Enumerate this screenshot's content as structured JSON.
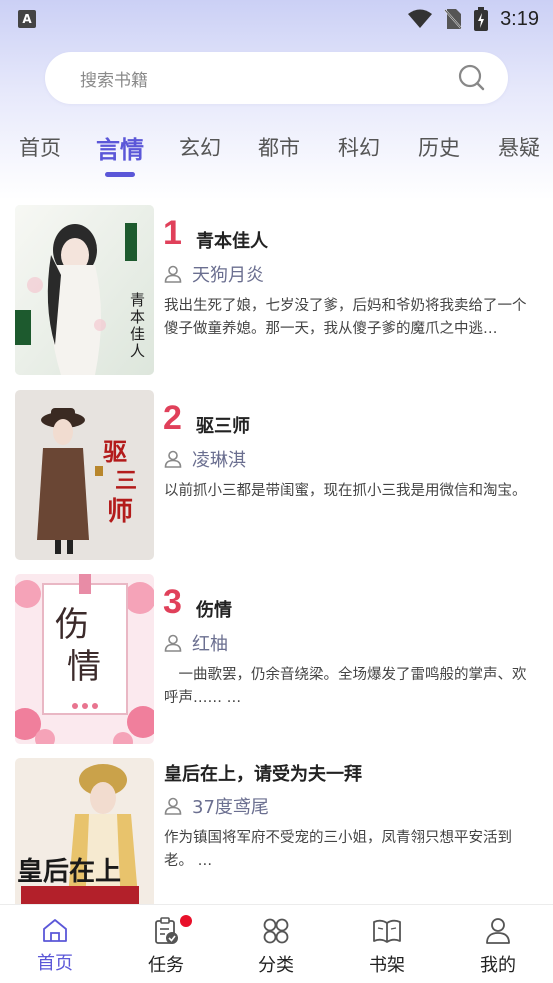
{
  "status_bar": {
    "app_badge": "A",
    "time": "3:19",
    "icons": [
      "wifi-icon",
      "no-sim-icon",
      "battery-charging-icon"
    ]
  },
  "search": {
    "placeholder": "搜索书籍",
    "icon": "search-icon"
  },
  "tabs": [
    {
      "label": "首页",
      "active": false
    },
    {
      "label": "言情",
      "active": true
    },
    {
      "label": "玄幻",
      "active": false
    },
    {
      "label": "都市",
      "active": false
    },
    {
      "label": "科幻",
      "active": false
    },
    {
      "label": "历史",
      "active": false
    },
    {
      "label": "悬疑",
      "active": false
    }
  ],
  "colors": {
    "accent": "#5b57d8",
    "rank": "#e0405a",
    "author": "#6b6f90",
    "badge": "#e8102a"
  },
  "books": [
    {
      "rank": "1",
      "title": "青本佳人",
      "author": "天狗月炎",
      "desc": "我出生死了娘，七岁没了爹，后妈和爷奶将我卖给了一个傻子做童养媳。那一天，我从傻子爹的魔爪之中逃…",
      "cover_text": "青本佳人"
    },
    {
      "rank": "2",
      "title": "驱三师",
      "author": "凌琳淇",
      "desc": "以前抓小三都是带闺蜜，现在抓小三我是用微信和淘宝。",
      "cover_text": "驱三师"
    },
    {
      "rank": "3",
      "title": "伤情",
      "author": "红柚",
      "desc": "　一曲歌罢，仍余音绕梁。全场爆发了雷鸣般的掌声、欢呼声…… …",
      "cover_text": "伤情"
    },
    {
      "rank": "",
      "title": "皇后在上，请受为夫一拜",
      "author": "37度鸢尾",
      "desc": "作为镇国将军府不受宠的三小姐，凤青翎只想平安活到老。 …",
      "cover_text": "皇后在上"
    }
  ],
  "bottom_nav": [
    {
      "label": "首页",
      "icon": "home-icon",
      "active": true
    },
    {
      "label": "任务",
      "icon": "task-clipboard-icon",
      "active": false,
      "badge": true
    },
    {
      "label": "分类",
      "icon": "category-grid-icon",
      "active": false
    },
    {
      "label": "书架",
      "icon": "bookshelf-icon",
      "active": false
    },
    {
      "label": "我的",
      "icon": "profile-icon",
      "active": false
    }
  ]
}
